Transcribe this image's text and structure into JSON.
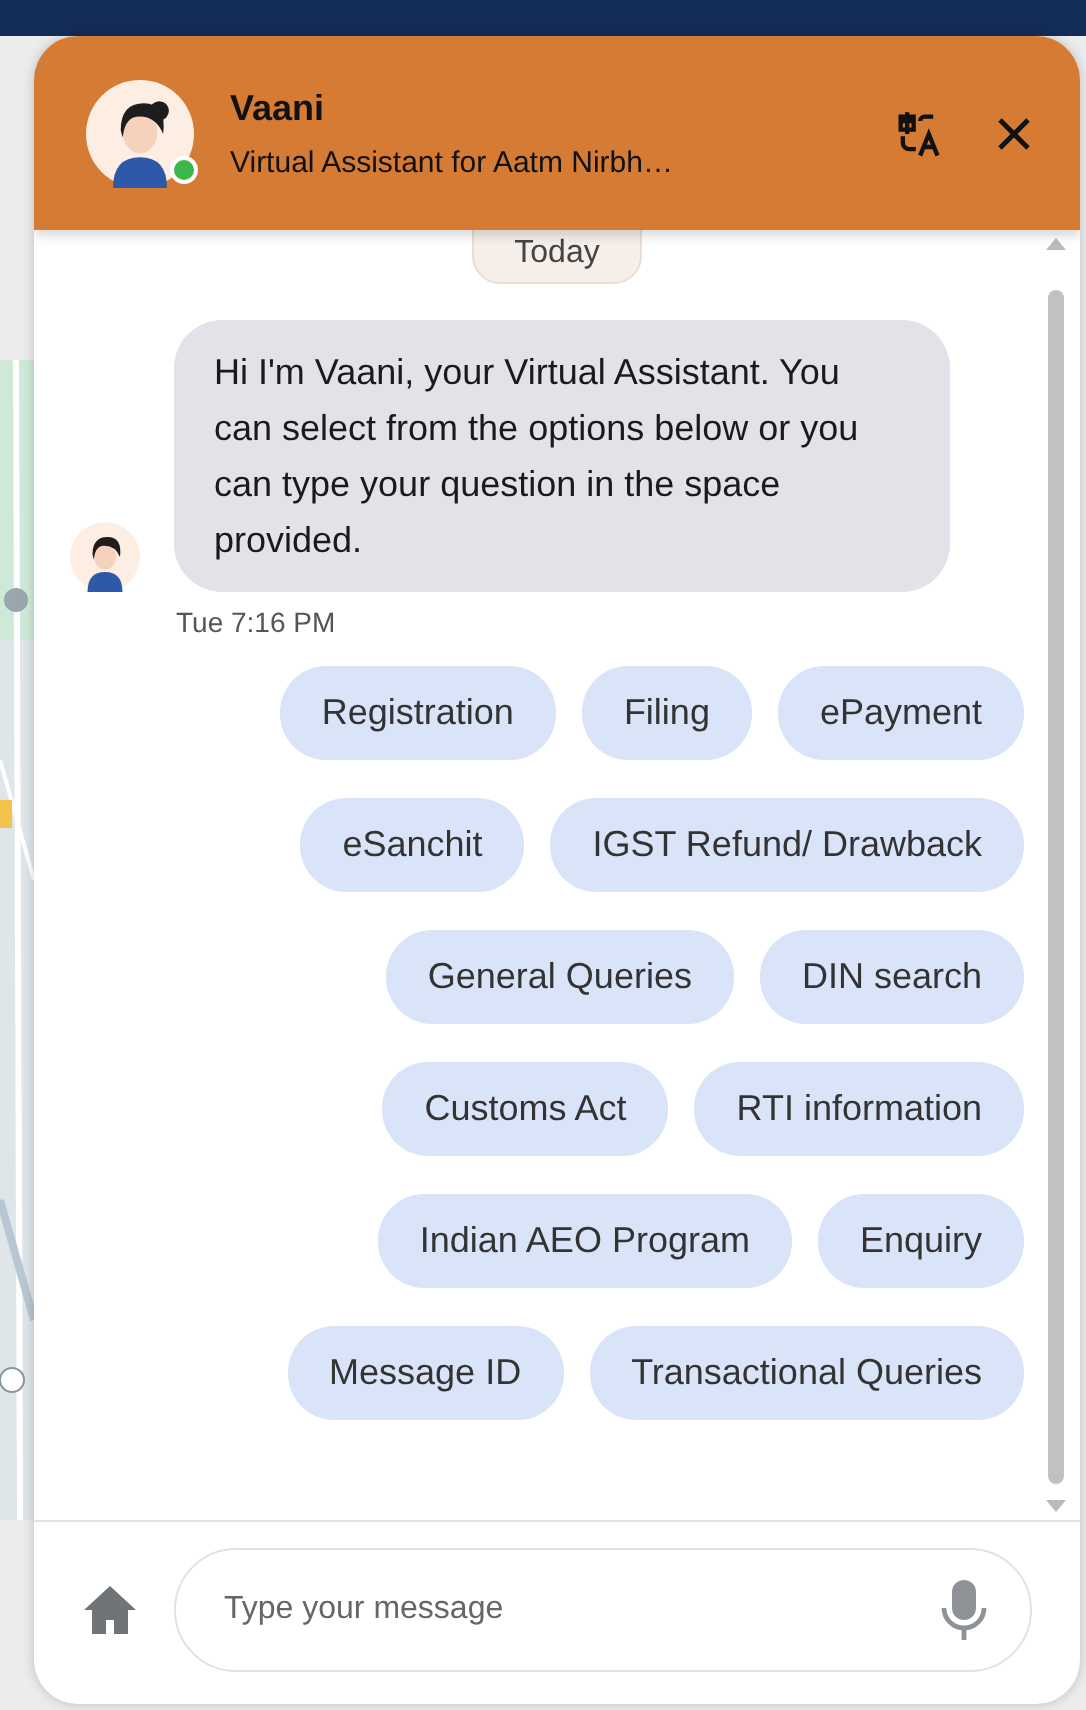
{
  "header": {
    "name": "Vaani",
    "subtitle": "Virtual Assistant for Aatm Nirbh…",
    "online": true
  },
  "date_divider": "Today",
  "message": {
    "text": "Hi I'm Vaani, your Virtual Assistant. You can select from the options below or you can type your question in the space provided.",
    "time": "Tue 7:16 PM"
  },
  "option_rows": [
    [
      "Registration",
      "Filing",
      "ePayment"
    ],
    [
      "eSanchit",
      "IGST Refund/ Drawback"
    ],
    [
      "General Queries",
      "DIN search"
    ],
    [
      "Customs Act",
      "RTI information"
    ],
    [
      "Indian AEO Program",
      "Enquiry"
    ],
    [
      "Message ID",
      "Transactional Queries"
    ]
  ],
  "composer": {
    "placeholder": "Type your message"
  }
}
